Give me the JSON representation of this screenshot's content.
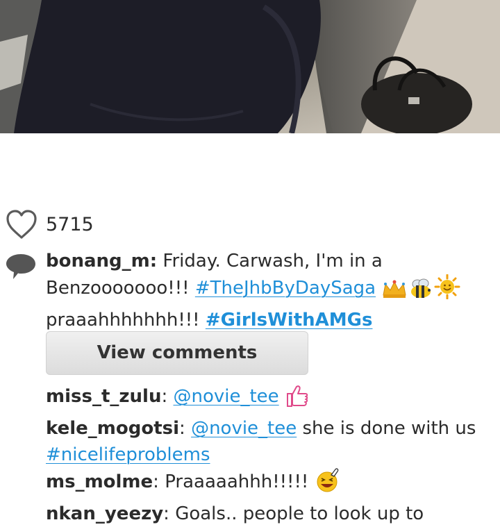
{
  "photo": {
    "description_icon": "post-photo"
  },
  "likes": {
    "count": "5715",
    "icon": "heart-icon"
  },
  "post": {
    "comment_icon": "comment-bubble-icon",
    "username": "bonang_m:",
    "caption_text_1": "Friday. Carwash, I'm in a Benzooooooo!!!",
    "hashtag_1": "#TheJhbByDaySaga",
    "caption_text_2": "praaahhhhhhh!!!",
    "hashtag_2": "#GirlsWithAMGs"
  },
  "view_comments_label": "View comments",
  "comments": [
    {
      "username": "miss_t_zulu",
      "sep": ":",
      "mention": "@novie_tee",
      "text": "",
      "hashtag": ""
    },
    {
      "username": "kele_mogotsi",
      "sep": ":",
      "mention": "@novie_tee",
      "text": "she is done with us",
      "hashtag": "#nicelifeproblems"
    },
    {
      "username": "ms_molme",
      "sep": ":",
      "mention": "",
      "text": "Praaaaahhh!!!!!",
      "hashtag": ""
    },
    {
      "username": "nkan_yeezy",
      "sep": ":",
      "mention": "",
      "text": "Goals.. people to look up to",
      "hashtag": ""
    }
  ],
  "colors": {
    "link": "#1f8fd8",
    "text": "#2b2b2b",
    "button_bg": "#e6e6e6"
  }
}
